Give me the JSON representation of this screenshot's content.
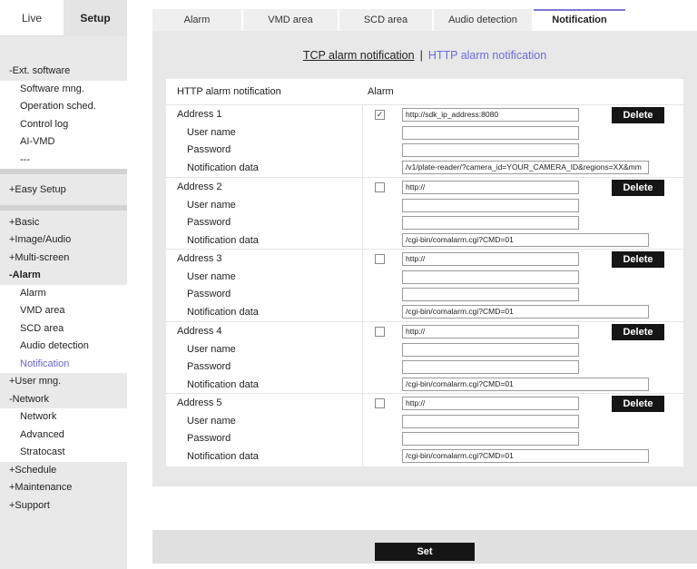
{
  "sidebar": {
    "top_tabs": {
      "live": "Live",
      "setup": "Setup"
    },
    "ext_software": {
      "label": "-Ext. software",
      "items": [
        "Software mng.",
        "Operation sched.",
        "Control log",
        "AI-VMD",
        "---"
      ]
    },
    "easy_setup": "+Easy Setup",
    "groups": {
      "basic": "+Basic",
      "image_audio": "+Image/Audio",
      "multi_screen": "+Multi-screen",
      "alarm": "-Alarm",
      "alarm_items": [
        "Alarm",
        "VMD area",
        "SCD area",
        "Audio detection",
        "Notification"
      ],
      "user_mng": "+User mng.",
      "network": "-Network",
      "network_items": [
        "Network",
        "Advanced",
        "Stratocast"
      ],
      "schedule": "+Schedule",
      "maintenance": "+Maintenance",
      "support": "+Support"
    },
    "active_color": "#6666cc"
  },
  "tabs": [
    "Alarm",
    "VMD area",
    "SCD area",
    "Audio detection",
    "Notification"
  ],
  "active_tab": "Notification",
  "subnav": {
    "tcp": "TCP alarm notification",
    "separator": "|",
    "http": "HTTP alarm notification"
  },
  "form": {
    "header_title": "HTTP alarm notification",
    "header_alarm": "Alarm",
    "labels": {
      "user": "User name",
      "password": "Password",
      "data": "Notification data"
    },
    "delete_label": "Delete",
    "addresses": [
      {
        "label": "Address 1",
        "checked": true,
        "url": "http://sdk_ip_address:8080",
        "user": "",
        "password": "",
        "data": "/v1/plate-reader/?camera_id=YOUR_CAMERA_ID&regions=XX&mm"
      },
      {
        "label": "Address 2",
        "checked": false,
        "url": "http://",
        "user": "",
        "password": "",
        "data": "/cgi-bin/comalarm.cgi?CMD=01"
      },
      {
        "label": "Address 3",
        "checked": false,
        "url": "http://",
        "user": "",
        "password": "",
        "data": "/cgi-bin/comalarm.cgi?CMD=01"
      },
      {
        "label": "Address 4",
        "checked": false,
        "url": "http://",
        "user": "",
        "password": "",
        "data": "/cgi-bin/comalarm.cgi?CMD=01"
      },
      {
        "label": "Address 5",
        "checked": false,
        "url": "http://",
        "user": "",
        "password": "",
        "data": "/cgi-bin/comalarm.cgi?CMD=01"
      }
    ]
  },
  "set_label": "Set",
  "check_glyph": "✓"
}
